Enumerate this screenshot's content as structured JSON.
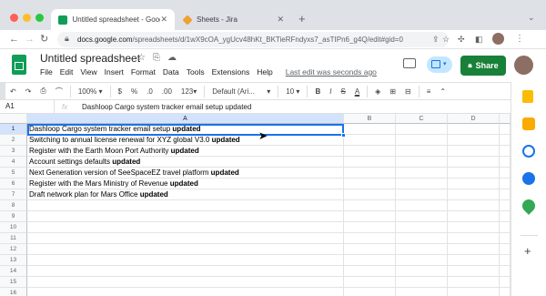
{
  "browser": {
    "tabs": [
      {
        "label": "Untitled spreadsheet - Googl",
        "active": true
      },
      {
        "label": "Sheets - Jira",
        "active": false
      }
    ],
    "new_tab": "+",
    "url_host": "docs.google.com",
    "url_rest": "/spreadsheets/d/1wX9cOA_ygUcv48hKt_BKTieRFndyxs7_asTIPn6_g4Q/edit#gid=0"
  },
  "doc": {
    "title": "Untitled spreadsheet",
    "menus": [
      "File",
      "Edit",
      "View",
      "Insert",
      "Format",
      "Data",
      "Tools",
      "Extensions",
      "Help"
    ],
    "last_edit": "Last edit was seconds ago",
    "share_label": "Share"
  },
  "toolbar": {
    "zoom": "100%",
    "currency": "$",
    "percent": "%",
    "decimal_less": ".0",
    "decimal_more": ".00",
    "format_more": "123",
    "font": "Default (Ari...",
    "font_size": "10",
    "bold": "B",
    "italic": "I",
    "strike": "S",
    "text_color": "A"
  },
  "formula_bar": {
    "cell_ref": "A1",
    "fx": "fx",
    "content": "Dashloop Cargo system tracker email setup updated"
  },
  "grid": {
    "columns": [
      "A",
      "B",
      "C",
      "D"
    ],
    "rows": [
      "1",
      "2",
      "3",
      "4",
      "5",
      "6",
      "7",
      "8",
      "9",
      "10",
      "11",
      "12",
      "13",
      "14",
      "15",
      "16",
      "17"
    ],
    "cells": [
      {
        "text": "Dashloop Cargo system tracker email setup",
        "bold": "updated"
      },
      {
        "text": "Switching to annual license renewal for XYZ global V3.0",
        "bold": "updated"
      },
      {
        "text": "Register with the Earth Moon Port Authority",
        "bold": "updated"
      },
      {
        "text": "Account settings defaults",
        "bold": "updated"
      },
      {
        "text": "Next Generation version of SeeSpaceEZ travel platform",
        "bold": "updated"
      },
      {
        "text": "Register with the Mars Ministry of Revenue",
        "bold": "updated"
      },
      {
        "text": "Draft network plan for Mars Office",
        "bold": "updated"
      }
    ]
  },
  "colors": {
    "share_green": "#188038",
    "selection_blue": "#1a73e8",
    "tab_bar": "#dee1e6"
  }
}
